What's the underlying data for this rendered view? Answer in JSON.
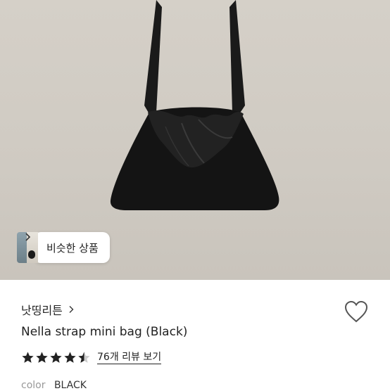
{
  "similar": {
    "label": "비슷한 상품"
  },
  "store": {
    "name": "낫띵리튼"
  },
  "product": {
    "title": "Nella strap mini bag (Black)",
    "rating": 4.5,
    "review_link": "76개 리뷰 보기",
    "color_label": "color",
    "color_value": "BLACK"
  },
  "icons": {
    "similar_chevron": "chevron-right-icon",
    "store_chevron": "chevron-right-icon",
    "wishlist": "heart-outline-icon",
    "rating": "star-icon"
  },
  "colors": {
    "background": "#ffffff",
    "text": "#222222",
    "muted": "#999999",
    "hero_bg": "#d2cdc5"
  }
}
